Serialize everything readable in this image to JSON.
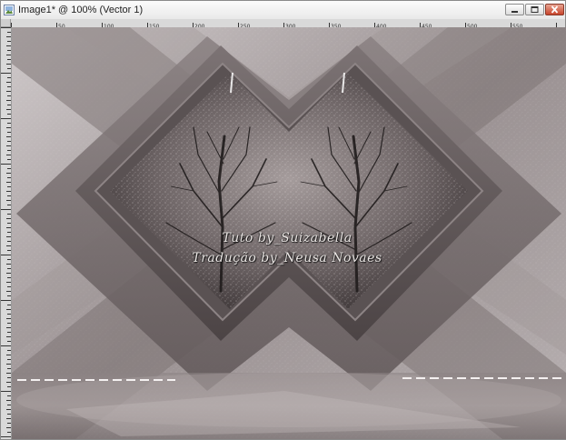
{
  "window": {
    "title": "Image1* @ 100% (Vector 1)"
  },
  "controls": {
    "minimize_icon": "minimize-icon",
    "maximize_icon": "maximize-icon",
    "close_icon": "close-icon"
  },
  "ruler": {
    "tick_labels": [
      "50",
      "100",
      "150",
      "200",
      "250",
      "300",
      "350",
      "400",
      "450",
      "500",
      "550"
    ]
  },
  "artwork": {
    "credit_line_1": "Tuto by_Suizabella",
    "credit_line_2": "Tradução by_Neusa Novaes"
  },
  "colors": {
    "close_button": "#c7432a",
    "canvas_base": "#6f6766",
    "light_mauve": "#b9b2b3"
  }
}
